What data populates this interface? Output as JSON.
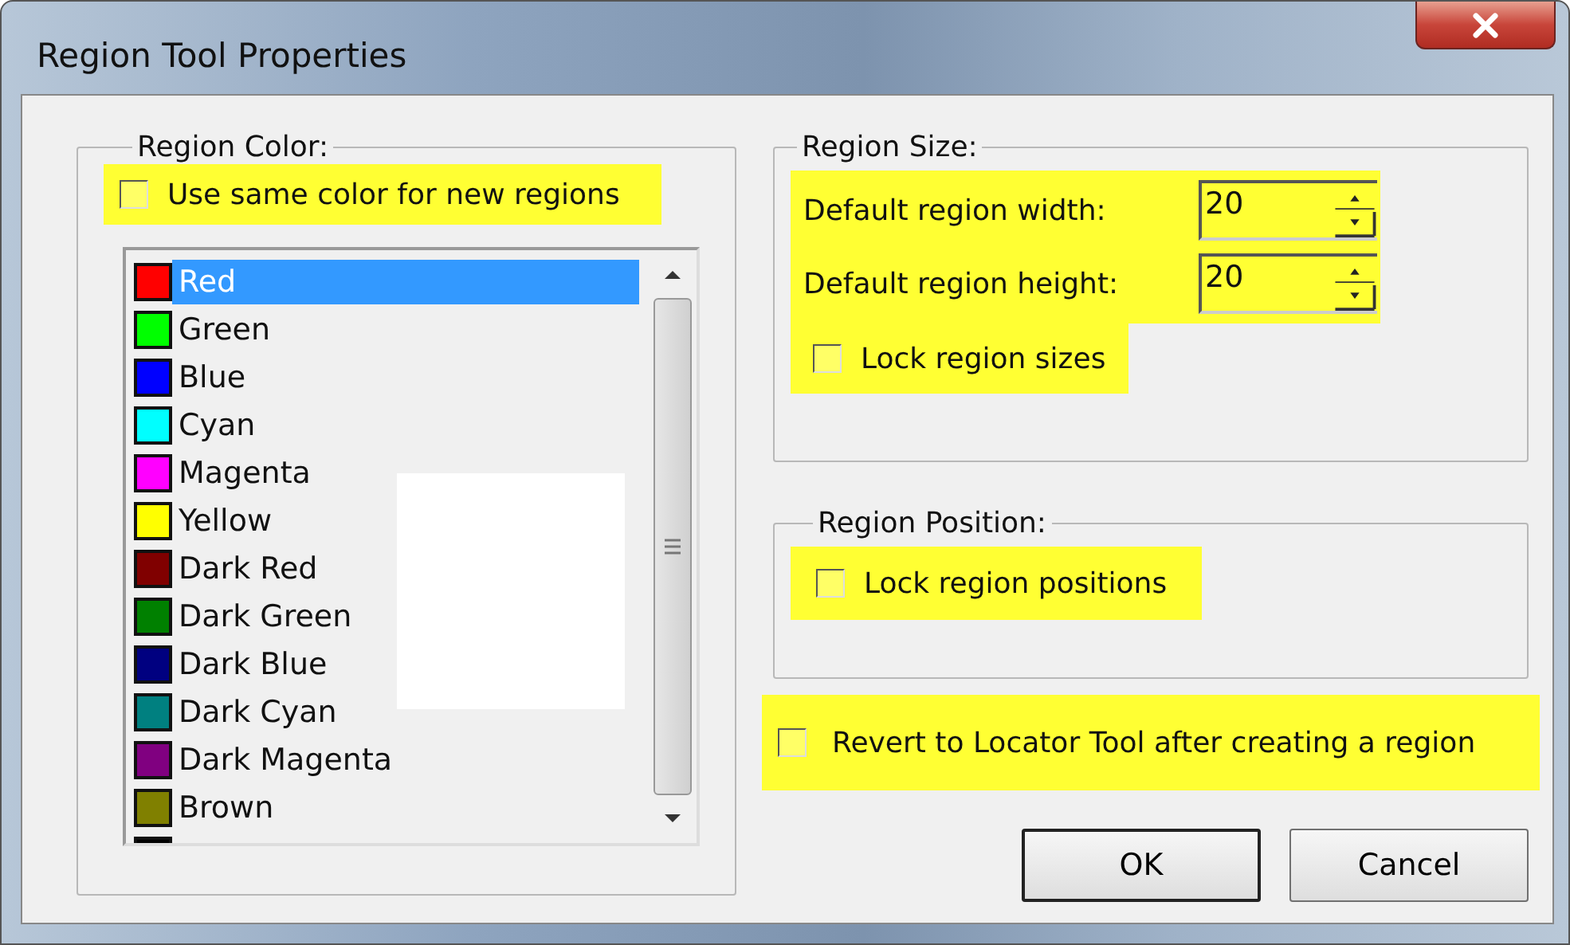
{
  "window": {
    "title": "Region Tool Properties"
  },
  "region_color": {
    "title": "Region Color:",
    "use_same_color": {
      "label": "Use same color for new regions",
      "checked": false
    },
    "colors": [
      {
        "label": "Red",
        "color": "#ff0000",
        "selected": true
      },
      {
        "label": "Green",
        "color": "#00ff00",
        "selected": false
      },
      {
        "label": "Blue",
        "color": "#0000ff",
        "selected": false
      },
      {
        "label": "Cyan",
        "color": "#00ffff",
        "selected": false
      },
      {
        "label": "Magenta",
        "color": "#ff00ff",
        "selected": false
      },
      {
        "label": "Yellow",
        "color": "#ffff00",
        "selected": false
      },
      {
        "label": "Dark Red",
        "color": "#800000",
        "selected": false
      },
      {
        "label": "Dark Green",
        "color": "#008000",
        "selected": false
      },
      {
        "label": "Dark Blue",
        "color": "#000080",
        "selected": false
      },
      {
        "label": "Dark Cyan",
        "color": "#008080",
        "selected": false
      },
      {
        "label": "Dark Magenta",
        "color": "#800080",
        "selected": false
      },
      {
        "label": "Brown",
        "color": "#808000",
        "selected": false
      },
      {
        "color": "#000000",
        "selected": false
      }
    ]
  },
  "region_size": {
    "title": "Region Size:",
    "fields": [
      {
        "label": "Default region width:",
        "value": "20"
      },
      {
        "label": "Default region height:",
        "value": "20"
      }
    ],
    "lock_sizes": {
      "label": "Lock region sizes",
      "checked": false
    }
  },
  "region_position": {
    "title": "Region Position:",
    "lock_positions": {
      "label": "Lock region positions",
      "checked": false
    }
  },
  "revert": {
    "label": "Revert to Locator Tool after creating a region",
    "checked": false
  },
  "buttons": [
    "OK",
    "Cancel"
  ]
}
